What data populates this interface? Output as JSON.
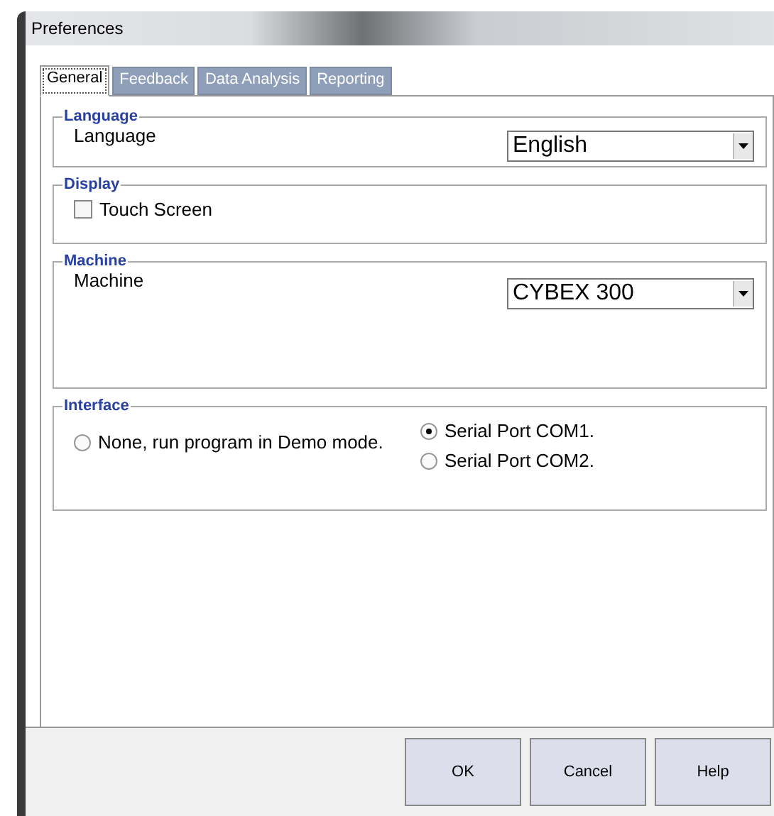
{
  "window": {
    "title": "Preferences"
  },
  "tabs": [
    {
      "label": "General",
      "selected": true
    },
    {
      "label": "Feedback",
      "selected": false
    },
    {
      "label": "Data Analysis",
      "selected": false
    },
    {
      "label": "Reporting",
      "selected": false
    }
  ],
  "language": {
    "title": "Language",
    "label": "Language",
    "value": "English"
  },
  "display": {
    "title": "Display",
    "touch_screen": {
      "label": "Touch Screen",
      "checked": false
    }
  },
  "machine": {
    "title": "Machine",
    "label": "Machine",
    "value": "CYBEX 300"
  },
  "interface": {
    "title": "Interface",
    "columns": [
      [
        {
          "label": "None, run program in Demo mode.",
          "selected": false
        }
      ],
      [
        {
          "label": "Serial Port COM1.",
          "selected": true
        },
        {
          "label": "Serial Port COM2.",
          "selected": false
        }
      ]
    ]
  },
  "buttons": [
    "OK",
    "Cancel",
    "Help"
  ]
}
